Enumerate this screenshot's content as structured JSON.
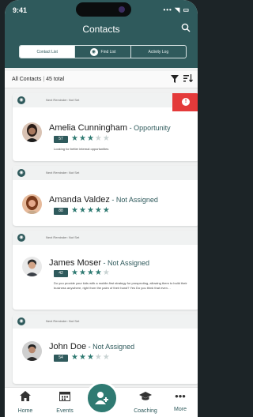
{
  "status_bar": {
    "time": "9:41",
    "icons": "••• ◥ ▭"
  },
  "header": {
    "title": "Contacts"
  },
  "tabs": [
    {
      "label": "Contact List",
      "active": true
    },
    {
      "label": "Find List",
      "active": false
    },
    {
      "label": "Activity Log",
      "active": false
    }
  ],
  "toolbar": {
    "filter_label": "All Contacts",
    "separator": "|",
    "count": "45 total"
  },
  "contacts": [
    {
      "reminder": "Next Reminder: Not Set",
      "name": "Amelia Cunningham",
      "sep": " - ",
      "status": "Opportunity",
      "score": "57",
      "rating": 3,
      "description": "Looking for better internal opportunities",
      "has_alert": true
    },
    {
      "reminder": "Next Reminder: Not Set",
      "name": "Amanda Valdez",
      "sep": " - ",
      "status": "Not Assigned",
      "score": "88",
      "rating": 5,
      "description": "",
      "has_alert": false
    },
    {
      "reminder": "Next Reminder: Not Set",
      "name": "James Moser",
      "sep": " - ",
      "status": "Not Assigned",
      "score": "42",
      "rating": 4,
      "description": "Do you provide your kids with a mobile-first strategy for prospecting, allowing them to build their business anywhere, right from the palm of their hand? Yes Do you think that even…",
      "has_alert": false
    },
    {
      "reminder": "Next Reminder: Not Set",
      "name": "John Doe",
      "sep": " - ",
      "status": "Not Assigned",
      "score": "54",
      "rating": 3,
      "description": "",
      "has_alert": false
    }
  ],
  "bottom_nav": [
    {
      "label": "Home",
      "icon": "home-icon"
    },
    {
      "label": "Events",
      "icon": "calendar-icon"
    },
    {
      "label": "",
      "icon": "add-contact-icon"
    },
    {
      "label": "Coaching",
      "icon": "graduation-cap-icon"
    },
    {
      "label": "More",
      "icon": "more-dots-icon"
    }
  ],
  "colors": {
    "primary": "#2f5a5c",
    "accent": "#2f7a72",
    "alert": "#e43a3a"
  }
}
